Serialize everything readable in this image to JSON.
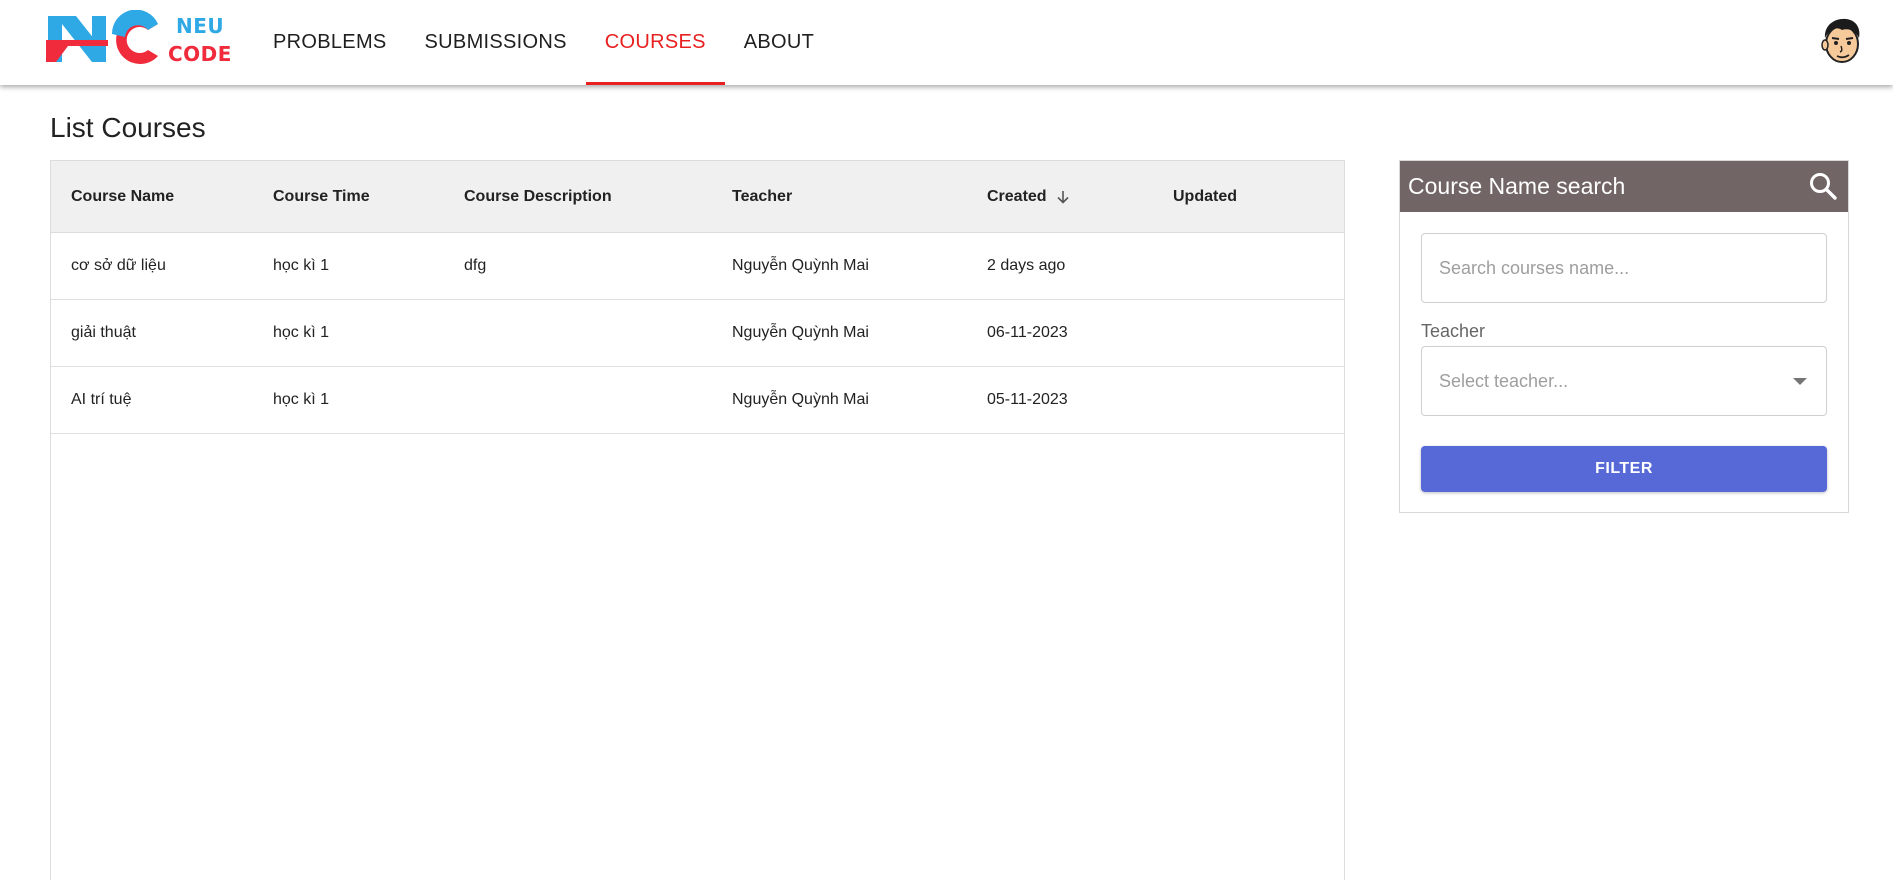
{
  "header": {
    "logo": {
      "mark": "NC",
      "line1": "NEU",
      "line2": "CODE"
    },
    "nav": [
      {
        "label": "PROBLEMS",
        "active": false
      },
      {
        "label": "SUBMISSIONS",
        "active": false
      },
      {
        "label": "COURSES",
        "active": true
      },
      {
        "label": "ABOUT",
        "active": false
      }
    ],
    "avatar_icon": "user-avatar-icon"
  },
  "page": {
    "title": "List Courses"
  },
  "table": {
    "columns": [
      "Course Name",
      "Course Time",
      "Course Description",
      "Teacher",
      "Created",
      "Updated"
    ],
    "sort": {
      "column": "Created",
      "direction": "desc",
      "icon": "arrow-down-icon"
    },
    "rows": [
      {
        "name": "cơ sở dữ liệu",
        "time": "học kì 1",
        "description": "dfg",
        "teacher": "Nguyễn Quỳnh Mai",
        "created": "2 days ago",
        "updated": ""
      },
      {
        "name": "giải thuật",
        "time": "học kì 1",
        "description": "",
        "teacher": "Nguyễn Quỳnh Mai",
        "created": "06-11-2023",
        "updated": ""
      },
      {
        "name": "AI trí tuệ",
        "time": "học kì 1",
        "description": "",
        "teacher": "Nguyễn Quỳnh Mai",
        "created": "05-11-2023",
        "updated": ""
      }
    ]
  },
  "sidebar": {
    "title": "Course Name search",
    "search_icon": "search-icon",
    "search_placeholder": "Search courses name...",
    "search_value": "",
    "teacher_label": "Teacher",
    "teacher_placeholder": "Select teacher...",
    "filter_label": "FILTER"
  },
  "colors": {
    "accent_red": "#e82020",
    "panel_header": "#726565",
    "filter_button": "#5669d6",
    "logo_blue": "#2fa8e6",
    "logo_red": "#ef2b3c"
  }
}
